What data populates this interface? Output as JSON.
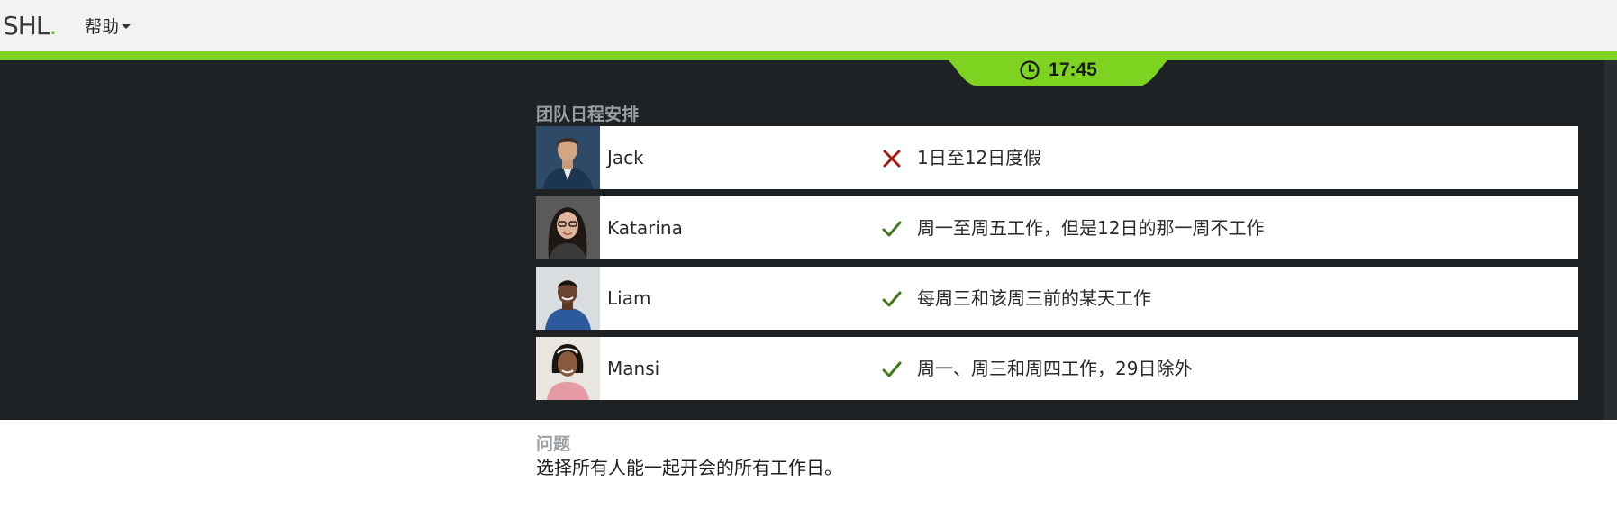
{
  "header": {
    "logo_text": "SHL",
    "logo_dot": ".",
    "help_label": "帮助",
    "accent_color": "#7ed321"
  },
  "timer": {
    "time": "17:45",
    "icon": "clock-icon"
  },
  "schedule": {
    "title": "团队日程安排",
    "members": [
      {
        "name": "Jack",
        "status": "unavailable",
        "status_icon": "x-icon",
        "note": "1日至12日度假"
      },
      {
        "name": "Katarina",
        "status": "available",
        "status_icon": "check-icon",
        "note": "周一至周五工作，但是12日的那一周不工作"
      },
      {
        "name": "Liam",
        "status": "available",
        "status_icon": "check-icon",
        "note": "每周三和该周三前的某天工作"
      },
      {
        "name": "Mansi",
        "status": "available",
        "status_icon": "check-icon",
        "note": "周一、周三和周四工作，29日除外"
      }
    ]
  },
  "question": {
    "label": "问题",
    "text": "选择所有人能一起开会的所有工作日。"
  }
}
